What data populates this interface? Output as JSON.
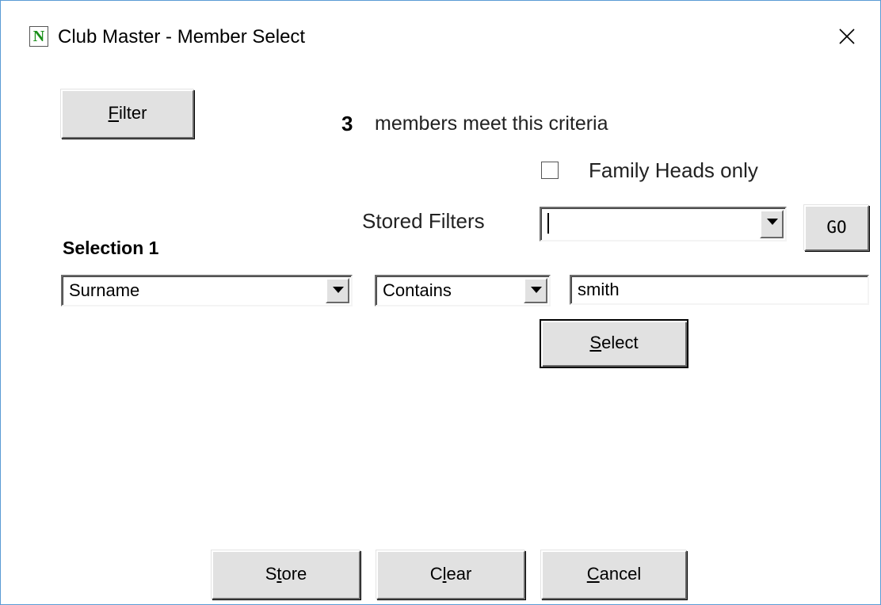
{
  "window": {
    "title": "Club Master - Member Select",
    "icon_letter": "N",
    "close_glyph": "×"
  },
  "filter_button": {
    "label_underlined": "F",
    "label_rest": "ilter"
  },
  "summary": {
    "count": "3",
    "text": "members meet this criteria"
  },
  "family_heads": {
    "label": "Family Heads only",
    "checked": false
  },
  "stored_filters": {
    "label": "Stored Filters",
    "value": "",
    "go_label": "GO"
  },
  "selection": {
    "heading": "Selection 1",
    "field": "Surname",
    "operator": "Contains",
    "value": "smith"
  },
  "select_button": {
    "label_underlined": "S",
    "label_rest": "elect"
  },
  "footer": {
    "store": {
      "before": "S",
      "underlined": "t",
      "after": "ore"
    },
    "clear": {
      "before": "C",
      "underlined": "l",
      "after": "ear"
    },
    "cancel": {
      "before": "",
      "underlined": "C",
      "after": "ancel"
    }
  },
  "colors": {
    "window_border": "#5a9bd5",
    "button_face": "#e1e1e1",
    "icon_letter": "#1a8f1a"
  }
}
